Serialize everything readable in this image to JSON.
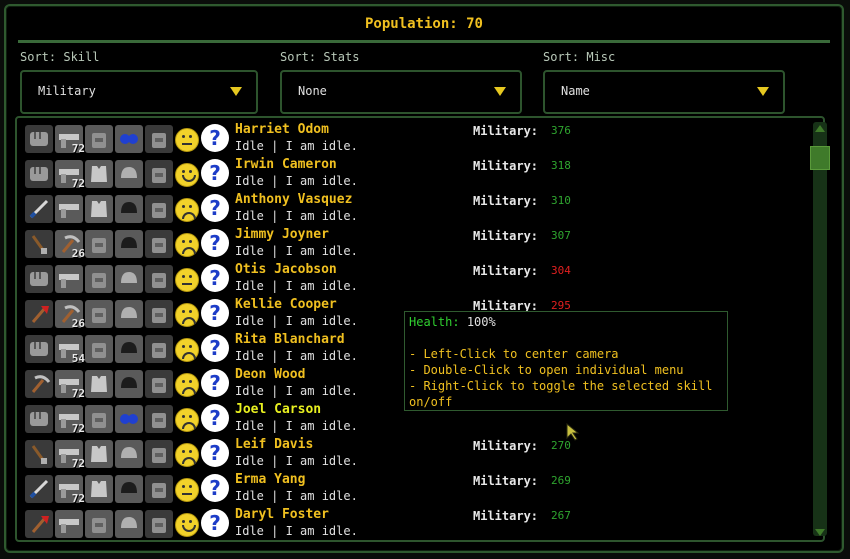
{
  "title": "Population: 70",
  "sorts": [
    {
      "label": "Sort: Skill",
      "value": "Military"
    },
    {
      "label": "Sort: Stats",
      "value": "None"
    },
    {
      "label": "Sort: Misc",
      "value": "Name"
    }
  ],
  "colonists": [
    {
      "name": "Harriet Odom",
      "status": "Idle | I am idle.",
      "skill_label": "Military:",
      "skill_value": "376",
      "skill_color": "#2fa52f",
      "ammo": "72",
      "mood": "neutral"
    },
    {
      "name": "Irwin Cameron",
      "status": "Idle | I am idle.",
      "skill_label": "Military:",
      "skill_value": "318",
      "skill_color": "#2fa52f",
      "ammo": "72",
      "mood": "happy"
    },
    {
      "name": "Anthony Vasquez",
      "status": "Idle | I am idle.",
      "skill_label": "Military:",
      "skill_value": "310",
      "skill_color": "#2fa52f",
      "ammo": "",
      "mood": "sad"
    },
    {
      "name": "Jimmy Joyner",
      "status": "Idle | I am idle.",
      "skill_label": "Military:",
      "skill_value": "307",
      "skill_color": "#2fa52f",
      "ammo": "26",
      "mood": "upset"
    },
    {
      "name": "Otis Jacobson",
      "status": "Idle | I am idle.",
      "skill_label": "Military:",
      "skill_value": "304",
      "skill_color": "#e02020",
      "ammo": "",
      "mood": "neutral"
    },
    {
      "name": "Kellie Cooper",
      "status": "Idle | I am idle.",
      "skill_label": "Military:",
      "skill_value": "295",
      "skill_color": "#e02020",
      "ammo": "26",
      "mood": "upset"
    },
    {
      "name": "Rita Blanchard",
      "status": "Idle | I am idle.",
      "skill_label": "",
      "skill_value": "",
      "skill_color": "#2fa52f",
      "ammo": "54",
      "mood": "sad"
    },
    {
      "name": "Deon Wood",
      "status": "Idle | I am idle.",
      "skill_label": "",
      "skill_value": "",
      "skill_color": "#2fa52f",
      "ammo": "72",
      "mood": "sad"
    },
    {
      "name": "Joel Carson",
      "status": "Idle | I am idle.",
      "skill_label": "",
      "skill_value": "",
      "skill_color": "#2fa52f",
      "ammo": "72",
      "mood": "upset",
      "highlight": true
    },
    {
      "name": "Leif Davis",
      "status": "Idle | I am idle.",
      "skill_label": "Military:",
      "skill_value": "270",
      "skill_color": "#2fa52f",
      "ammo": "72",
      "mood": "sad"
    },
    {
      "name": "Erma Yang",
      "status": "Idle | I am idle.",
      "skill_label": "Military:",
      "skill_value": "269",
      "skill_color": "#2fa52f",
      "ammo": "72",
      "mood": "neutral"
    },
    {
      "name": "Daryl Foster",
      "status": "Idle | I am idle.",
      "skill_label": "Military:",
      "skill_value": "267",
      "skill_color": "#2fa52f",
      "ammo": "",
      "mood": "happy"
    }
  ],
  "tooltip": {
    "health_label": "Health:",
    "health_value": "100%",
    "lines": [
      "- Left-Click to center camera",
      "- Double-Click to open individual menu",
      "- Right-Click to toggle the selected skill",
      "on/off"
    ]
  },
  "colors": {
    "accent": "#f0c020",
    "border": "#2f5a2f",
    "skill_high": "#2fa52f",
    "skill_low": "#e02020"
  }
}
